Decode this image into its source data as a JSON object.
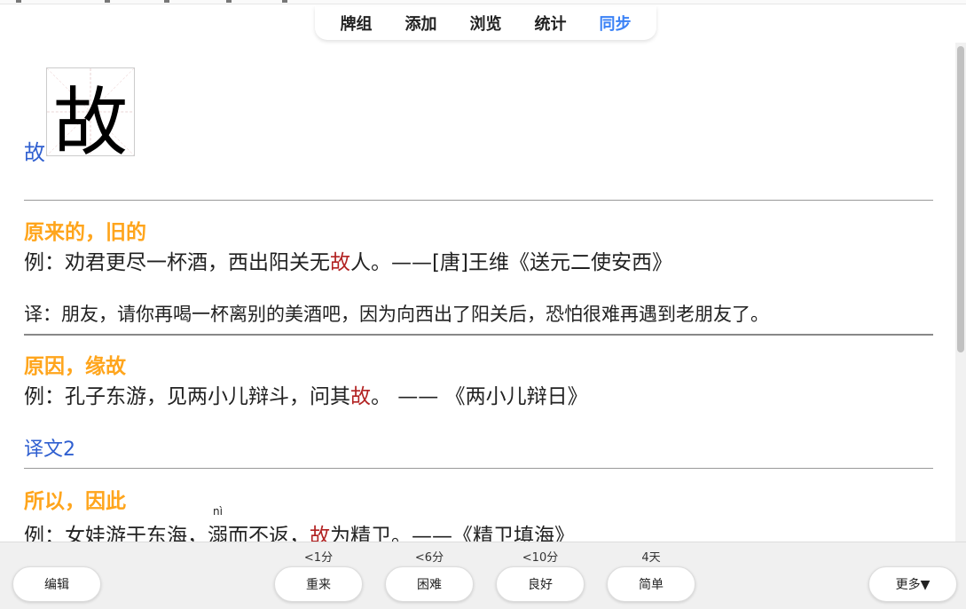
{
  "top_nav": {
    "items": [
      {
        "label": "牌组"
      },
      {
        "label": "添加"
      },
      {
        "label": "浏览"
      },
      {
        "label": "统计"
      },
      {
        "label": "同步"
      }
    ],
    "active_index": 4,
    "active_color": "#3b82f6"
  },
  "card": {
    "character_link": "故",
    "character_glyph": "故",
    "definitions": [
      {
        "meaning": "原来的，旧的",
        "example_before": "例：劝君更尽一杯酒，西出阳关无",
        "example_highlight": "故",
        "example_after": "人。——[唐]王维《送元二使安西》",
        "translation": "译：朋友，请你再喝一杯离别的美酒吧，因为向西出了阳关后，恐怕很难再遇到老朋友了。"
      },
      {
        "meaning": "原因，缘故",
        "example_before": "例：孔子东游，见两小儿辩斗，问其",
        "example_highlight": "故",
        "example_after": "。 —— 《两小儿辩日》",
        "translation_link": "译文2"
      },
      {
        "meaning": "所以，因此",
        "example_before": "例：女娃游于东海，",
        "example_ruby_char": "溺",
        "example_ruby_pinyin": "nì",
        "example_mid": "而不返，",
        "example_highlight": "故",
        "example_after": "为精卫。——《精卫填海》"
      }
    ],
    "meaning_color": "#ffa51c",
    "highlight_color": "#b22222",
    "link_color": "#2f5fd0"
  },
  "bottom_bar": {
    "edit_label": "编辑",
    "more_label": "更多▼",
    "answers": [
      {
        "label": "重来",
        "interval": "<1分"
      },
      {
        "label": "困难",
        "interval": "<6分"
      },
      {
        "label": "良好",
        "interval": "<10分"
      },
      {
        "label": "简单",
        "interval": "4天"
      }
    ]
  }
}
